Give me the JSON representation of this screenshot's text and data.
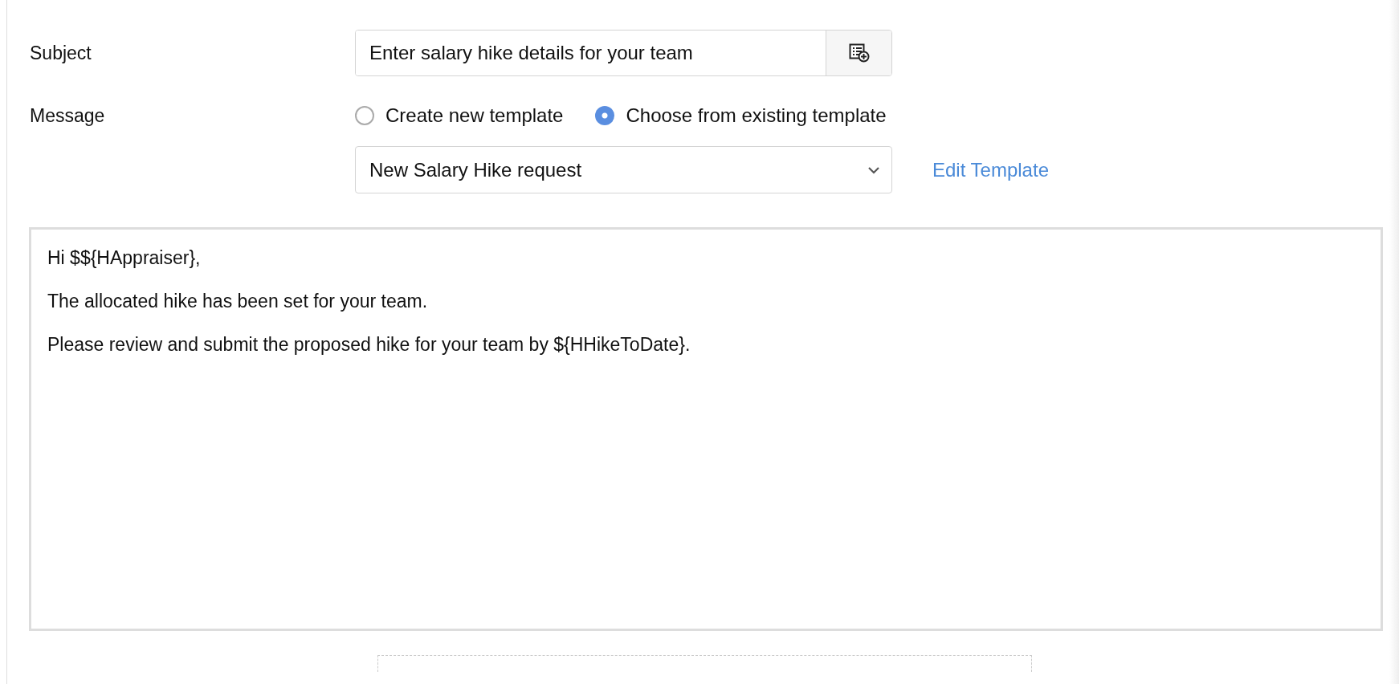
{
  "subject": {
    "label": "Subject",
    "value": "Enter salary hike details for your team"
  },
  "message": {
    "label": "Message",
    "options": [
      {
        "label": "Create new template",
        "selected": false
      },
      {
        "label": "Choose from existing template",
        "selected": true
      }
    ],
    "template": {
      "value": "New Salary Hike request"
    },
    "edit_link": "Edit Template",
    "body": [
      "Hi $${HAppraiser},",
      "The allocated hike has been set for your team.",
      "Please review and submit the proposed hike for your team by ${HHikeToDate}."
    ]
  }
}
